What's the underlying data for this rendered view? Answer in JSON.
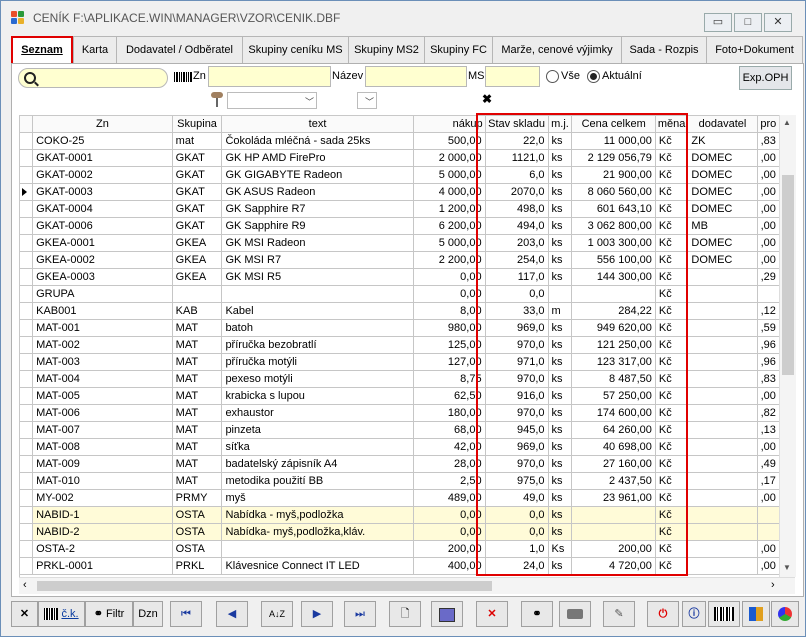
{
  "window": {
    "title": "CENÍK F:\\APLIKACE.WIN\\MANAGER\\VZOR\\CENIK.DBF",
    "buttons": {
      "minimize": "▭",
      "maximize": "□",
      "close": "✕"
    }
  },
  "tabs": [
    "Seznam",
    "Karta",
    "Dodavatel / Odběratel",
    "Skupiny ceníku MS",
    "Skupiny MS2",
    "Skupiny FC",
    "Marže, cenové výjimky",
    "Sada - Rozpis",
    "Foto+Dokument"
  ],
  "filters": {
    "zn_label": "Zn",
    "nazev_label": "Název",
    "ms_label": "MS",
    "radio_all": "Vše",
    "radio_current": "Aktuální",
    "export_label": "Exp.OPH",
    "clear_symbol": "✖"
  },
  "grid": {
    "columns": [
      "Zn",
      "Skupina",
      "text",
      "nákup",
      "Stav skladu",
      "m.j.",
      "Cena celkem",
      "měna",
      "dodavatel",
      "pro"
    ],
    "rows": [
      [
        "COKO-25",
        "mat",
        "Čokoláda mléčná - sada 25ks",
        "500,00",
        "22,0",
        "ks",
        "11 000,00",
        "Kč",
        "ZK",
        ",83"
      ],
      [
        "GKAT-0001",
        "GKAT",
        "GK HP AMD FirePro",
        "2 000,00",
        "1121,0",
        "ks",
        "2 129 056,79",
        "Kč",
        "DOMEC",
        ",00"
      ],
      [
        "GKAT-0002",
        "GKAT",
        "GK  GIGABYTE Radeon",
        "5 000,00",
        "6,0",
        "ks",
        "21 900,00",
        "Kč",
        "DOMEC",
        ",00"
      ],
      [
        "GKAT-0003",
        "GKAT",
        "GK ASUS Radeon",
        "4 000,00",
        "2070,0",
        "ks",
        "8 060 560,00",
        "Kč",
        "DOMEC",
        ",00"
      ],
      [
        "GKAT-0004",
        "GKAT",
        "GK Sapphire R7",
        "1 200,00",
        "498,0",
        "ks",
        "601 643,10",
        "Kč",
        "DOMEC",
        ",00"
      ],
      [
        "GKAT-0006",
        "GKAT",
        "GK Sapphire R9",
        "6 200,00",
        "494,0",
        "ks",
        "3 062 800,00",
        "Kč",
        "MB",
        ",00"
      ],
      [
        "GKEA-0001",
        "GKEA",
        "GK MSI  Radeon",
        "5 000,00",
        "203,0",
        "ks",
        "1 003 300,00",
        "Kč",
        "DOMEC",
        ",00"
      ],
      [
        "GKEA-0002",
        "GKEA",
        "GK MSI R7",
        "2 200,00",
        "254,0",
        "ks",
        "556 100,00",
        "Kč",
        "DOMEC",
        ",00"
      ],
      [
        "GKEA-0003",
        "GKEA",
        "GK MSI R5",
        "0,00",
        "117,0",
        "ks",
        "144 300,00",
        "Kč",
        "",
        ",29"
      ],
      [
        "GRUPA",
        "",
        "",
        "0,00",
        "0,0",
        "",
        "",
        "Kč",
        "",
        ""
      ],
      [
        "KAB001",
        "KAB",
        "Kabel",
        "8,00",
        "33,0",
        "m",
        "284,22",
        "Kč",
        "",
        ",12"
      ],
      [
        "MAT-001",
        "MAT",
        "batoh",
        "980,00",
        "969,0",
        "ks",
        "949 620,00",
        "Kč",
        "",
        ",59"
      ],
      [
        "MAT-002",
        "MAT",
        "příručka bezobratlí",
        "125,00",
        "970,0",
        "ks",
        "121 250,00",
        "Kč",
        "",
        ",96"
      ],
      [
        "MAT-003",
        "MAT",
        "příručka motýli",
        "127,00",
        "971,0",
        "ks",
        "123 317,00",
        "Kč",
        "",
        ",96"
      ],
      [
        "MAT-004",
        "MAT",
        "pexeso motýli",
        "8,75",
        "970,0",
        "ks",
        "8 487,50",
        "Kč",
        "",
        ",83"
      ],
      [
        "MAT-005",
        "MAT",
        "krabicka s lupou",
        "62,50",
        "916,0",
        "ks",
        "57 250,00",
        "Kč",
        "",
        ",00"
      ],
      [
        "MAT-006",
        "MAT",
        "exhaustor",
        "180,00",
        "970,0",
        "ks",
        "174 600,00",
        "Kč",
        "",
        ",82"
      ],
      [
        "MAT-007",
        "MAT",
        "pinzeta",
        "68,00",
        "945,0",
        "ks",
        "64 260,00",
        "Kč",
        "",
        ",13"
      ],
      [
        "MAT-008",
        "MAT",
        "síťka",
        "42,00",
        "969,0",
        "ks",
        "40 698,00",
        "Kč",
        "",
        ",00"
      ],
      [
        "MAT-009",
        "MAT",
        "badatelský zápisník A4",
        "28,00",
        "970,0",
        "ks",
        "27 160,00",
        "Kč",
        "",
        ",49"
      ],
      [
        "MAT-010",
        "MAT",
        "metodika použití BB",
        "2,50",
        "975,0",
        "ks",
        "2 437,50",
        "Kč",
        "",
        ",17"
      ],
      [
        "MY-002",
        "PRMY",
        "myš",
        "489,00",
        "49,0",
        "ks",
        "23 961,00",
        "Kč",
        "",
        ",00"
      ],
      [
        "NABID-1",
        "OSTA",
        "Nabídka - myš,podložka",
        "0,00",
        "0,0",
        "ks",
        "",
        "Kč",
        "",
        ""
      ],
      [
        "NABID-2",
        "OSTA",
        "Nabídka- myš,podložka,kláv.",
        "0,00",
        "0,0",
        "ks",
        "",
        "Kč",
        "",
        ""
      ],
      [
        "OSTA-2",
        "OSTA",
        "",
        "200,00",
        "1,0",
        "Ks",
        "200,00",
        "Kč",
        "",
        ",00"
      ],
      [
        "PRKL-0001",
        "PRKL",
        "Klávesnice Connect IT LED",
        "400,00",
        "24,0",
        "ks",
        "4 720,00",
        "Kč",
        "",
        ",00"
      ]
    ]
  },
  "toolbar": {
    "ck_label": "č.k.",
    "filtr_label": "Filtr",
    "dzn_label": "Dzn",
    "sort_label": "A↓Z",
    "first": "⏮",
    "prev": "◀",
    "next": "▶",
    "last": "⏭",
    "new": "🗋",
    "close": "✕",
    "power": "⏻",
    "info": "ⓘ"
  }
}
